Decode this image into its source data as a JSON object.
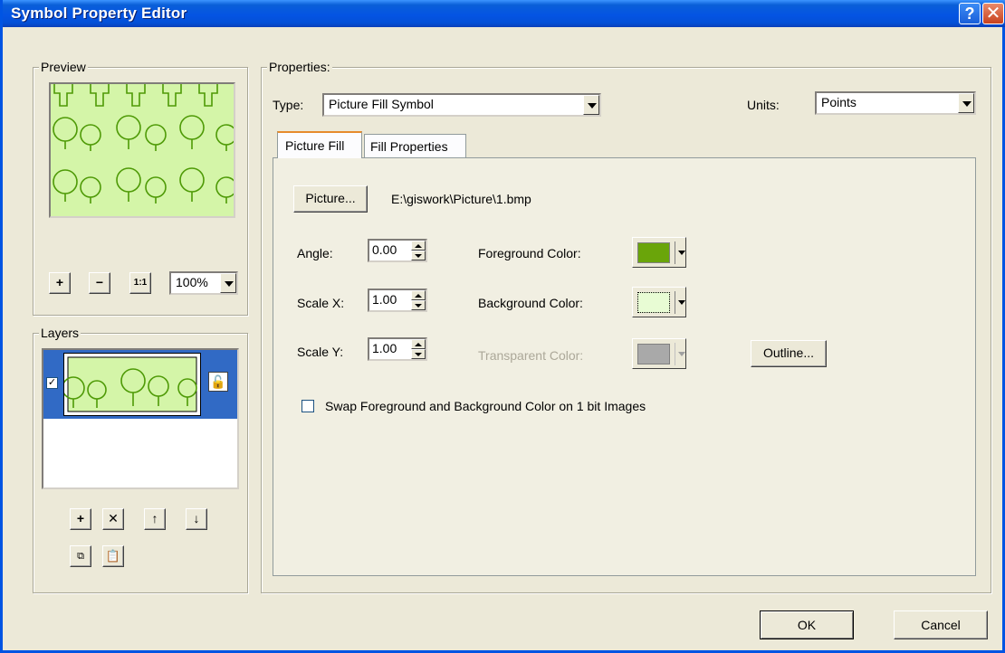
{
  "window": {
    "title": "Symbol Property Editor"
  },
  "title_buttons": {
    "help": "?",
    "close": "✕"
  },
  "preview": {
    "group_label": "Preview",
    "zoom_value": "100%",
    "buttons": {
      "zoom_in": "+",
      "zoom_out": "−",
      "actual_size": "1:1"
    },
    "fill_color": "#d4f5a8",
    "stroke_color": "#4e9a06"
  },
  "layers": {
    "group_label": "Layers",
    "items": [
      {
        "checked": true,
        "selected": true,
        "locked": false
      }
    ],
    "buttons": {
      "add": "+",
      "remove": "✕",
      "up": "↑",
      "down": "↓",
      "copy": "copy",
      "paste": "paste"
    }
  },
  "properties": {
    "group_label": "Properties:",
    "type_label": "Type:",
    "type_value": "Picture Fill Symbol",
    "units_label": "Units:",
    "units_value": "Points",
    "tabs": [
      {
        "label": "Picture Fill",
        "active": true
      },
      {
        "label": "Fill Properties",
        "active": false
      }
    ],
    "picture_button": "Picture...",
    "picture_path": "E:\\giswork\\Picture\\1.bmp",
    "angle_label": "Angle:",
    "angle_value": "0.00",
    "scalex_label": "Scale X:",
    "scalex_value": "1.00",
    "scaley_label": "Scale Y:",
    "scaley_value": "1.00",
    "foreground_label": "Foreground Color:",
    "foreground_color": "#6aa50a",
    "background_label": "Background Color:",
    "background_color": "#e8fcd4",
    "transparent_label": "Transparent Color:",
    "transparent_color": "#a9a9a9",
    "outline_button": "Outline...",
    "swap_label": "Swap Foreground and Background Color on 1 bit Images",
    "swap_checked": false
  },
  "footer": {
    "ok": "OK",
    "cancel": "Cancel"
  }
}
